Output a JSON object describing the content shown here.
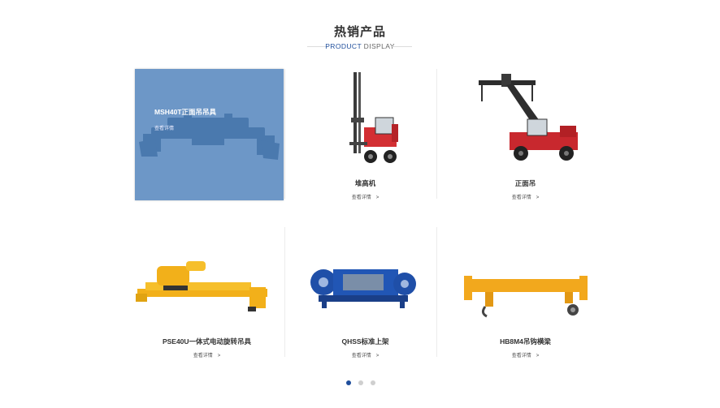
{
  "section": {
    "title": "热销产品",
    "subtitle_accent": "PRODUCT",
    "subtitle_rest": " DISPLAY"
  },
  "products": [
    {
      "name": "MSH40T正面吊吊具",
      "more": "查看详情",
      "active": true
    },
    {
      "name": "堆高机",
      "more": "查看详情",
      "arrow": ">"
    },
    {
      "name": "正面吊",
      "more": "查看详情",
      "arrow": ">"
    },
    {
      "name": "PSE40U一体式电动旋转吊具",
      "more": "查看详情",
      "arrow": ">"
    },
    {
      "name": "QHSS标准上架",
      "more": "查看详情",
      "arrow": ">"
    },
    {
      "name": "HB8M4吊钩横梁",
      "more": "查看详情",
      "arrow": ">"
    }
  ],
  "pagination": {
    "count": 3,
    "active_index": 0
  },
  "colors": {
    "accent": "#1f4e9c",
    "overlay": "#6d97c7",
    "yellow": "#f4b41a",
    "red": "#c8282e",
    "blue_machine": "#1f4fa8"
  }
}
